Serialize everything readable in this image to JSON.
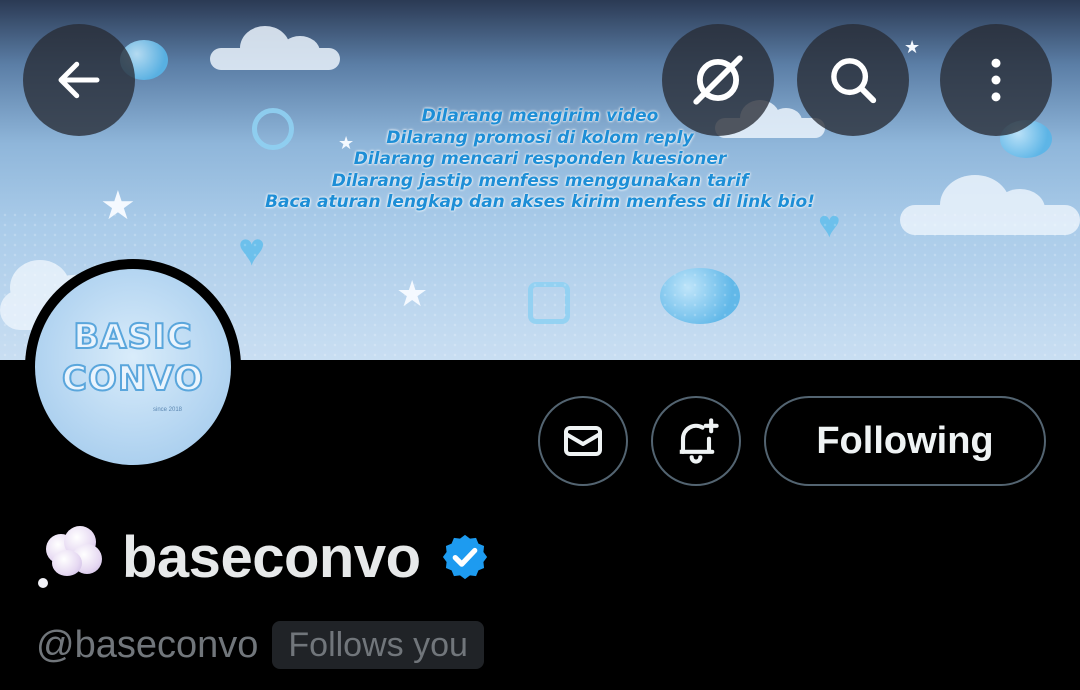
{
  "header": {
    "back_icon": "arrow-left-icon",
    "grok_icon": "grok-icon",
    "search_icon": "search-icon",
    "more_icon": "more-vertical-icon"
  },
  "banner": {
    "rules": [
      "Dilarang mengirim video",
      "Dilarang promosi di kolom reply",
      "Dilarang mencari responden kuesioner",
      "Dilarang jastip menfess menggunakan tarif",
      "Baca aturan lengkap dan akses kirim menfess di link bio!"
    ],
    "text_color": "#1d8ed6"
  },
  "avatar": {
    "line1": "BASIC",
    "line2": "CONVO",
    "small_text": "since 2018"
  },
  "actions": {
    "message_icon": "mail-icon",
    "notify_icon": "bell-plus-icon",
    "following_label": "Following"
  },
  "profile": {
    "display_name": "baseconvo",
    "name_emoji": "thought-balloon-icon",
    "verified_icon": "verified-badge-icon",
    "handle": "@baseconvo",
    "follows_you": "Follows you"
  },
  "colors": {
    "verified": "#1d9bf0",
    "border": "#536471",
    "muted": "#71767b"
  }
}
